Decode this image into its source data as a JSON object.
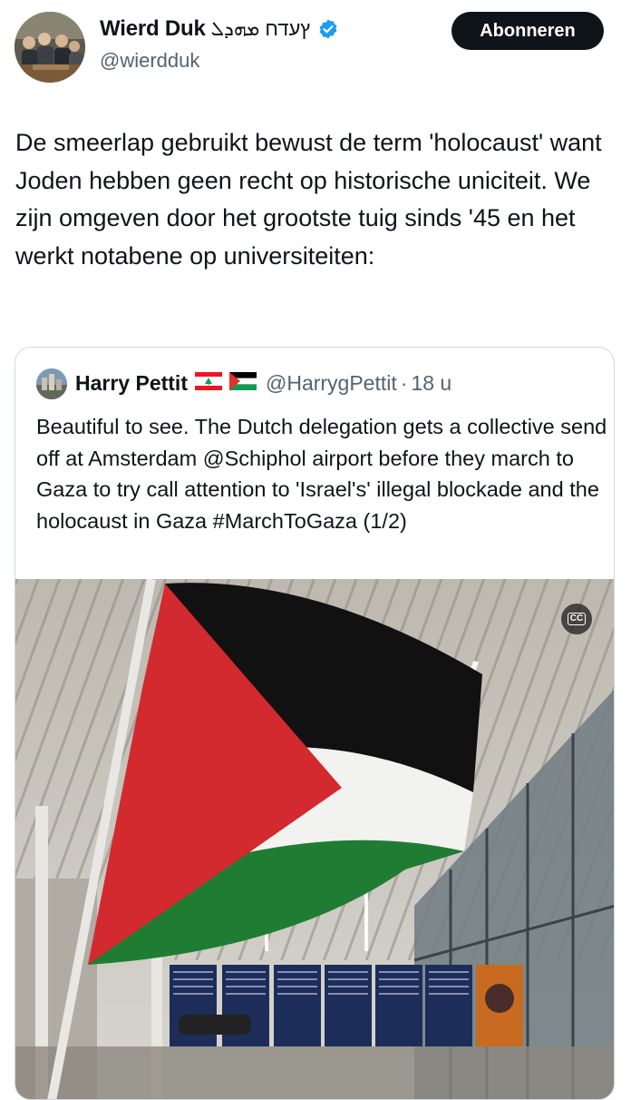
{
  "author": {
    "display_name": "Wierd Duk",
    "name_suffix": "ץעדח ܡܗܕܠ",
    "handle": "@wierdduk",
    "verified": true,
    "verified_color": "#1d9bf0"
  },
  "follow_button": {
    "label": "Abonneren"
  },
  "tweet": {
    "text": "De smeerlap gebruikt bewust de term 'holocaust' want Joden hebben geen recht op historische uniciteit. We zijn omgeven door het grootste tuig sinds '45 en het werkt notabene op universiteiten:"
  },
  "quote": {
    "display_name": "Harry Pettit",
    "flags": [
      "lebanon-flag-icon",
      "palestine-flag-icon"
    ],
    "handle": "@HarrygPettit",
    "separator": "·",
    "time": "18 u",
    "text": "Beautiful to see. The Dutch delegation gets a collective send off at Amsterdam @Schiphol airport before they march to Gaza to try call attention to 'Israel's' illegal blockade and the holocaust in Gaza #MarchToGaza (1/2)",
    "media": {
      "type": "video",
      "cc_label": "CC"
    }
  },
  "colors": {
    "text": "#0f1419",
    "secondary": "#536471",
    "border": "#cfd9de",
    "button_bg": "#0f1419",
    "flag_red": "#d22a2e",
    "flag_green": "#1f7d33"
  }
}
